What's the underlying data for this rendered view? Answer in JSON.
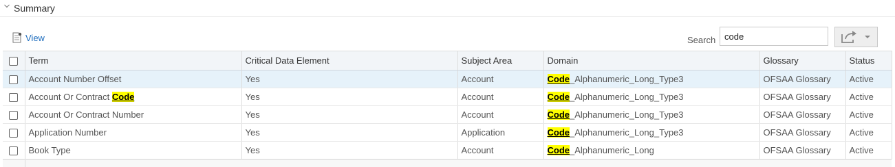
{
  "summary": {
    "title": "Summary"
  },
  "toolbar": {
    "view_label": "View",
    "search_label": "Search",
    "search_value": "code"
  },
  "colors": {
    "highlight": "#ffff00",
    "selected_row": "#e6f2fa",
    "link": "#1b6bbd"
  },
  "table": {
    "columns": [
      "Term",
      "Critical Data Element",
      "Subject Area",
      "Domain",
      "Glossary",
      "Status"
    ],
    "rows": [
      {
        "term": "Account Number Offset",
        "term_match": "",
        "cde": "Yes",
        "subject_area": "Account",
        "domain_match": "Code",
        "domain_rest": "_Alphanumeric_Long_Type3",
        "glossary": "OFSAA Glossary",
        "status": "Active"
      },
      {
        "term": "Account Or Contract ",
        "term_match": "Code",
        "cde": "Yes",
        "subject_area": "Account",
        "domain_match": "Code",
        "domain_rest": "_Alphanumeric_Long_Type3",
        "glossary": "OFSAA Glossary",
        "status": "Active"
      },
      {
        "term": "Account Or Contract Number",
        "term_match": "",
        "cde": "Yes",
        "subject_area": "Account",
        "domain_match": "Code",
        "domain_rest": "_Alphanumeric_Long_Type3",
        "glossary": "OFSAA Glossary",
        "status": "Active"
      },
      {
        "term": "Application Number",
        "term_match": "",
        "cde": "Yes",
        "subject_area": "Application",
        "domain_match": "Code",
        "domain_rest": "_Alphanumeric_Long_Type3",
        "glossary": "OFSAA Glossary",
        "status": "Active"
      },
      {
        "term": "Book Type",
        "term_match": "",
        "cde": "Yes",
        "subject_area": "Account",
        "domain_match": "Code",
        "domain_rest": "_Alphanumeric_Long",
        "glossary": "OFSAA Glossary",
        "status": "Active"
      }
    ]
  }
}
